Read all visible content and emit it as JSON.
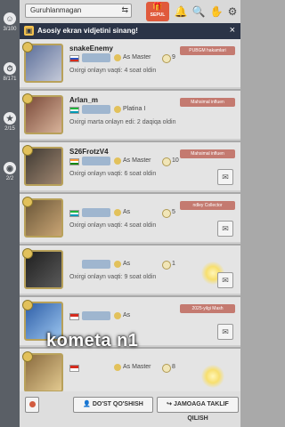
{
  "rail": {
    "items": [
      {
        "icon": "person-icon",
        "glyph": "☺",
        "count": "3/100"
      },
      {
        "icon": "clock-icon",
        "glyph": "⏱",
        "count": "8/171"
      },
      {
        "icon": "star-icon",
        "glyph": "★",
        "count": "2/15"
      },
      {
        "icon": "location-icon",
        "glyph": "◉",
        "count": "2/2"
      }
    ]
  },
  "topbar": {
    "group_select_label": "Guruhlanmagan",
    "switch_glyph": "⇆",
    "sepul_label": "SEPUL",
    "icons": [
      "bell-icon",
      "search-icon",
      "gift-icon",
      "hand-icon",
      "gear-icon"
    ]
  },
  "banner": {
    "text": "Asosiy ekran vidjetini sinang!",
    "close": "×"
  },
  "friends": [
    {
      "name": "snakeEnemy",
      "rank_text": "As Master",
      "level": "9",
      "status": "Oxirgi onlayn vaqti: 4 soat oldin",
      "tag": "PUBGM hakamlari",
      "action": "message"
    },
    {
      "name": "Arlan_m",
      "rank_text": "Platina I",
      "level": "",
      "status": "Oxirgi marta onlayn edi: 2 daqiqa oldin",
      "tag": "Mahsimal influen",
      "action": "message"
    },
    {
      "name": "S26FrotzV4",
      "rank_text": "As Master",
      "level": "10",
      "status": "Oxirgi onlayn vaqti: 6 soat oldin",
      "tag": "Mahsimal influen",
      "action": "message"
    },
    {
      "name": "",
      "rank_text": "As",
      "level": "5",
      "status": "Oxirgi onlayn vaqti: 4 soat oldin",
      "tag": "ndley Collector",
      "action": "message"
    },
    {
      "name": "",
      "rank_text": "As",
      "level": "1",
      "status": "Oxirgi onlayn vaqti: 9 soat oldin",
      "tag": "",
      "action": "glow"
    },
    {
      "name": "",
      "rank_text": "As",
      "level": "",
      "status": "",
      "tag": "2025-yilgi Mash",
      "action": "message"
    },
    {
      "name": "",
      "rank_text": "As Master",
      "level": "8",
      "status": "",
      "tag": "",
      "action": "glow"
    }
  ],
  "overlay_text": "kometa n1",
  "bottom": {
    "add_friend": "DO'ST QO'SHISH",
    "invite": "JAMOAGA TAKLIF QILISH"
  },
  "colors": {
    "rail": "#5a5f66",
    "banner": "#2b3447",
    "sepul": "#e05a3c",
    "tag": "#c47a70"
  }
}
